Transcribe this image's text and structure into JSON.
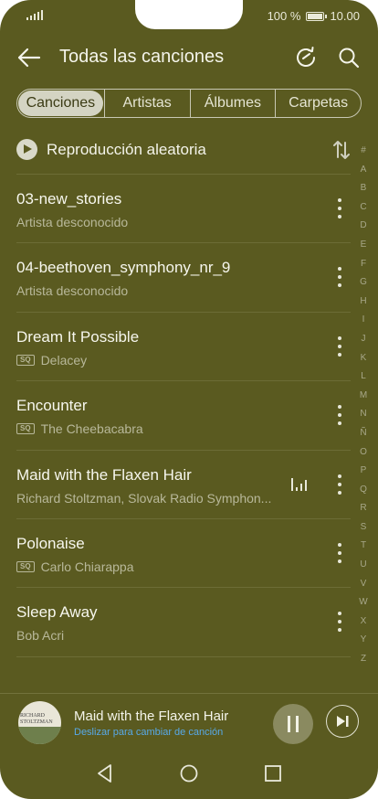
{
  "status": {
    "battery_percent": "100 %",
    "time": "10.00",
    "signal_icon": "signal-icon",
    "battery_icon": "battery-icon"
  },
  "appbar": {
    "title": "Todas las canciones"
  },
  "tabs": [
    {
      "label": "Canciones",
      "active": true
    },
    {
      "label": "Artistas",
      "active": false
    },
    {
      "label": "Álbumes",
      "active": false
    },
    {
      "label": "Carpetas",
      "active": false
    }
  ],
  "shuffle": {
    "label": "Reproducción aleatoria"
  },
  "songs": [
    {
      "title": "03-new_stories",
      "artist": "Artista desconocido",
      "sq": false,
      "playing": false
    },
    {
      "title": "04-beethoven_symphony_nr_9",
      "artist": "Artista desconocido",
      "sq": false,
      "playing": false
    },
    {
      "title": "Dream It Possible",
      "artist": "Delacey",
      "sq": true,
      "playing": false
    },
    {
      "title": "Encounter",
      "artist": "The Cheebacabra",
      "sq": true,
      "playing": false
    },
    {
      "title": "Maid with the Flaxen Hair",
      "artist": "Richard Stoltzman, Slovak Radio Symphon...",
      "sq": false,
      "playing": true
    },
    {
      "title": "Polonaise",
      "artist": "Carlo Chiarappa",
      "sq": true,
      "playing": false
    },
    {
      "title": "Sleep Away",
      "artist": "Bob Acri",
      "sq": false,
      "playing": false
    }
  ],
  "sq_badge": "SQ",
  "alphabet": [
    "#",
    "A",
    "B",
    "C",
    "D",
    "E",
    "F",
    "G",
    "H",
    "I",
    "J",
    "K",
    "L",
    "M",
    "N",
    "Ñ",
    "O",
    "P",
    "Q",
    "R",
    "S",
    "T",
    "U",
    "V",
    "W",
    "X",
    "Y",
    "Z"
  ],
  "player": {
    "title": "Maid with the Flaxen Hair",
    "subtitle": "Deslizar para cambiar de canción",
    "cover_text": "RICHARD STOLTZMAN"
  },
  "colors": {
    "background": "#5a5a20",
    "accent_link": "#58a9e8"
  }
}
